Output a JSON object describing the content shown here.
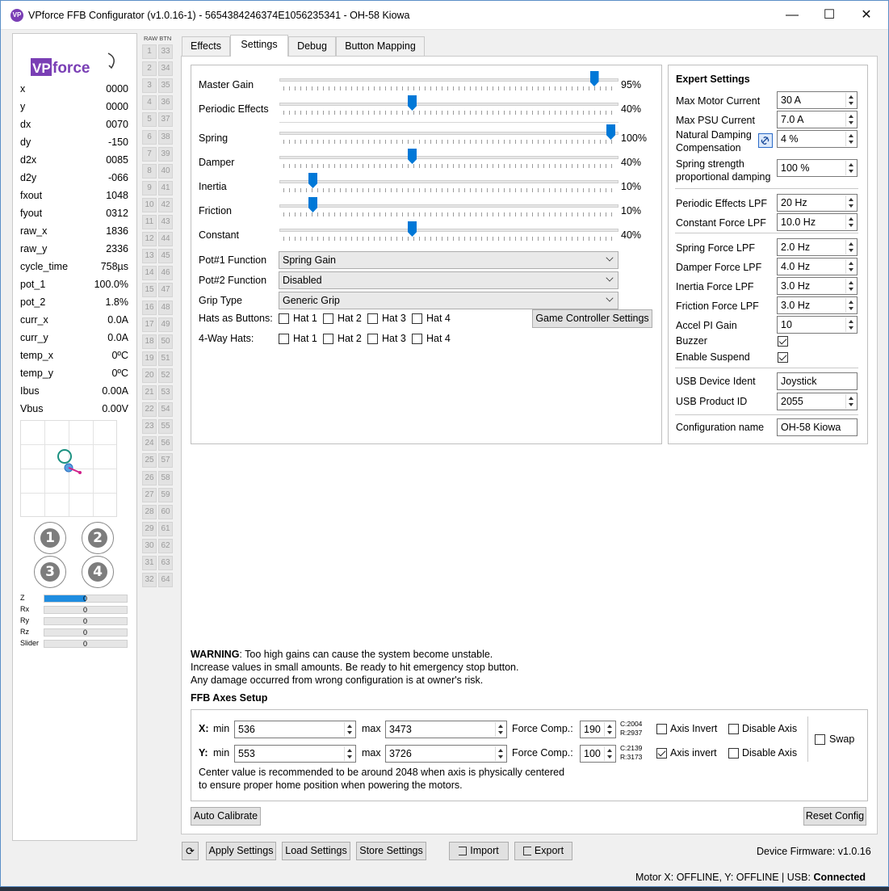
{
  "window": {
    "title": "VPforce FFB Configurator (v1.0.16-1) - 5654384246374E1056235341 - OH-58 Kiowa",
    "minimize": "—",
    "maximize": "☐",
    "close": "✕"
  },
  "left_panel": {
    "logo_text": "VPforce",
    "values": [
      {
        "label": "x",
        "value": "0000"
      },
      {
        "label": "y",
        "value": "0000"
      },
      {
        "label": "dx",
        "value": "0070"
      },
      {
        "label": "dy",
        "value": "-150"
      },
      {
        "label": "d2x",
        "value": "0085"
      },
      {
        "label": "d2y",
        "value": "-066"
      },
      {
        "label": "fxout",
        "value": "1048"
      },
      {
        "label": "fyout",
        "value": "0312"
      },
      {
        "label": "raw_x",
        "value": "1836"
      },
      {
        "label": "raw_y",
        "value": "2336"
      },
      {
        "label": "cycle_time",
        "value": "758µs"
      },
      {
        "label": "pot_1",
        "value": "100.0%"
      },
      {
        "label": "pot_2",
        "value": "1.8%"
      },
      {
        "label": "curr_x",
        "value": "0.0A"
      },
      {
        "label": "curr_y",
        "value": "0.0A"
      },
      {
        "label": "temp_x",
        "value": "0ºC"
      },
      {
        "label": "temp_y",
        "value": "0ºC"
      },
      {
        "label": "Ibus",
        "value": "0.00A"
      },
      {
        "label": "Vbus",
        "value": "0.00V"
      }
    ],
    "hat_buttons": [
      "1",
      "2",
      "3",
      "4"
    ],
    "axes": [
      {
        "label": "Z",
        "value": "0",
        "fill": 0.5
      },
      {
        "label": "Rx",
        "value": "0",
        "fill": 0
      },
      {
        "label": "Ry",
        "value": "0",
        "fill": 0
      },
      {
        "label": "Rz",
        "value": "0",
        "fill": 0
      },
      {
        "label": "Slider",
        "value": "0",
        "fill": 0
      }
    ],
    "accent": "#1f8de0"
  },
  "raw_btn": {
    "header": "RAW BTN",
    "col1": [
      "1",
      "2",
      "3",
      "4",
      "5",
      "6",
      "7",
      "8",
      "9",
      "10",
      "11",
      "12",
      "13",
      "14",
      "15",
      "16",
      "17",
      "18",
      "19",
      "20",
      "21",
      "22",
      "23",
      "24",
      "25",
      "26",
      "27",
      "28",
      "29",
      "30",
      "31",
      "32"
    ],
    "col2": [
      "33",
      "34",
      "35",
      "36",
      "37",
      "38",
      "39",
      "40",
      "41",
      "42",
      "43",
      "44",
      "45",
      "46",
      "47",
      "48",
      "49",
      "50",
      "51",
      "52",
      "53",
      "54",
      "55",
      "56",
      "57",
      "58",
      "59",
      "60",
      "61",
      "62",
      "63",
      "64"
    ]
  },
  "tabs": [
    "Effects",
    "Settings",
    "Debug",
    "Button Mapping"
  ],
  "active_tab": "Settings",
  "sliders": [
    {
      "label": "Master Gain",
      "value": 95,
      "text": "95%"
    },
    {
      "label": "Periodic Effects",
      "value": 40,
      "text": "40%"
    },
    {
      "label": "Spring",
      "value": 100,
      "text": "100%"
    },
    {
      "label": "Damper",
      "value": 40,
      "text": "40%"
    },
    {
      "label": "Inertia",
      "value": 10,
      "text": "10%"
    },
    {
      "label": "Friction",
      "value": 10,
      "text": "10%"
    },
    {
      "label": "Constant",
      "value": 40,
      "text": "40%"
    }
  ],
  "combos": [
    {
      "label": "Pot#1 Function",
      "value": "Spring Gain"
    },
    {
      "label": "Pot#2 Function",
      "value": "Disabled"
    },
    {
      "label": "Grip Type",
      "value": "Generic Grip"
    }
  ],
  "hats_as_buttons": {
    "label": "Hats as Buttons:",
    "items": [
      "Hat 1",
      "Hat 2",
      "Hat 3",
      "Hat 4"
    ]
  },
  "four_way_hats": {
    "label": "4-Way Hats:",
    "items": [
      "Hat 1",
      "Hat 2",
      "Hat 3",
      "Hat 4"
    ]
  },
  "game_controller_button": "Game Controller Settings",
  "expert": {
    "title": "Expert Settings",
    "rows": [
      {
        "label": "Max Motor Current",
        "value": "30 A"
      },
      {
        "label": "Max PSU Current",
        "value": "7.0 A"
      },
      {
        "label": "Natural Damping",
        "label2": "Compensation",
        "value": "4 %"
      },
      {
        "label": "Spring strength",
        "label2": "proportional damping",
        "value": "100 %"
      },
      {
        "label": "Periodic Effects LPF",
        "value": "20 Hz"
      },
      {
        "label": "Constant Force LPF",
        "value": "10.0 Hz"
      },
      {
        "label": "Spring Force LPF",
        "value": "2.0 Hz"
      },
      {
        "label": "Damper Force LPF",
        "value": "4.0 Hz"
      },
      {
        "label": "Inertia Force LPF",
        "value": "3.0 Hz"
      },
      {
        "label": "Friction Force LPF",
        "value": "3.0 Hz"
      },
      {
        "label": "Accel PI Gain",
        "value": "10"
      }
    ],
    "buzzer": "Buzzer",
    "enable_suspend": "Enable Suspend",
    "usb_ident_label": "USB Device Ident",
    "usb_ident_value": "Joystick",
    "usb_pid_label": "USB Product ID",
    "usb_pid_value": "2055",
    "config_name_label": "Configuration name",
    "config_name_value": "OH-58 Kiowa"
  },
  "warning": {
    "bold": "WARNING",
    "line1": ": Too high gains can cause the system become unstable.",
    "line2": "Increase values in small amounts. Be ready to hit emergency stop button.",
    "line3": "Any damage occurred from wrong configuration is at owner's risk."
  },
  "ffb_axes": {
    "title": "FFB Axes Setup",
    "x": {
      "axis": "X:",
      "min_label": "min",
      "min": "536",
      "max_label": "max",
      "max": "3473",
      "force_label": "Force Comp.:",
      "force": "190",
      "c": "C:2004",
      "r": "R:2937",
      "invert_label": "Axis Invert",
      "invert": false,
      "disable_label": "Disable Axis",
      "disable": false
    },
    "y": {
      "axis": "Y:",
      "min_label": "min",
      "min": "553",
      "max_label": "max",
      "max": "3726",
      "force_label": "Force Comp.:",
      "force": "100",
      "c": "C:2139",
      "r": "R:3173",
      "invert_label": "Axis invert",
      "invert": true,
      "disable_label": "Disable Axis",
      "disable": false
    },
    "swap": "Swap",
    "note1": "Center value is recommended to be around 2048 when axis is physically centered",
    "note2": "to ensure proper home position when powering the motors."
  },
  "buttons": {
    "auto_calibrate": "Auto Calibrate",
    "reset_config": "Reset Config",
    "refresh": "⟳",
    "apply": "Apply Settings",
    "load": "Load Settings",
    "store": "Store Settings",
    "import": "Import",
    "export": "Export"
  },
  "firmware": "Device Firmware:  v1.0.16",
  "status": {
    "text": "Motor X: OFFLINE, Y: OFFLINE | USB: ",
    "connected": "Connected"
  }
}
